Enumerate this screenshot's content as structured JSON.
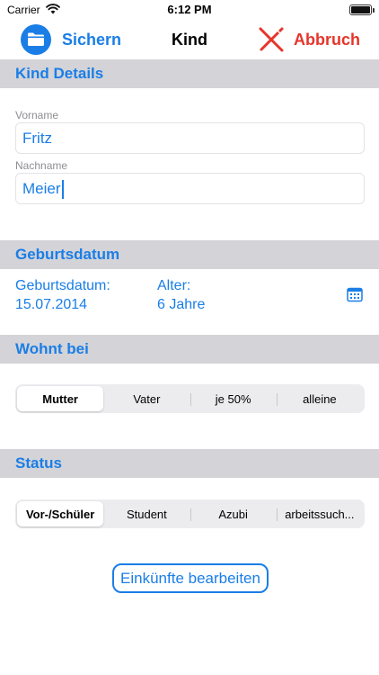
{
  "status_bar": {
    "carrier": "Carrier",
    "time": "6:12 PM"
  },
  "nav": {
    "left_label": "Sichern",
    "title": "Kind",
    "right_label": "Abbruch"
  },
  "sections": {
    "details": {
      "header": "Kind Details"
    },
    "birthdate": {
      "header": "Geburtsdatum"
    },
    "lives_with": {
      "header": "Wohnt bei"
    },
    "status": {
      "header": "Status"
    }
  },
  "details": {
    "first_name_label": "Vorname",
    "first_name_value": "Fritz",
    "last_name_label": "Nachname",
    "last_name_value": "Meier"
  },
  "birthdate": {
    "label": "Geburtsdatum:",
    "value": "15.07.2014",
    "age_label": "Alter:",
    "age_value": "6 Jahre"
  },
  "lives_with": {
    "options": [
      "Mutter",
      "Vater",
      "je 50%",
      "alleine"
    ],
    "selected": "Mutter"
  },
  "status": {
    "options": [
      "Vor-/Schüler",
      "Student",
      "Azubi",
      "arbeitssuch..."
    ],
    "selected": "Vor-/Schüler"
  },
  "actions": {
    "edit_income": "Einkünfte bearbeiten"
  },
  "colors": {
    "accent": "#1a7ee6",
    "cancel": "#e5352b",
    "section_bg": "#d3d3d8"
  },
  "icons": {
    "save": "folder-icon",
    "cancel": "cross-pencil-icon",
    "calendar": "calendar-icon",
    "wifi": "wifi-icon",
    "battery": "battery-icon"
  }
}
